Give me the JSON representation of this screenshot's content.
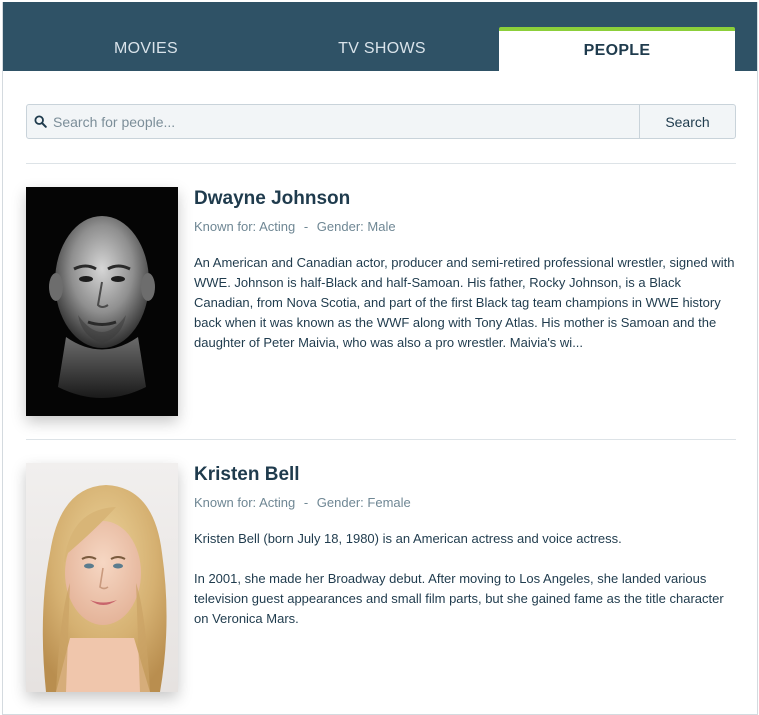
{
  "tabs": [
    {
      "label": "MOVIES",
      "active": false
    },
    {
      "label": "TV SHOWS",
      "active": false
    },
    {
      "label": "PEOPLE",
      "active": true
    }
  ],
  "search": {
    "placeholder": "Search for people...",
    "value": "",
    "button_label": "Search"
  },
  "colors": {
    "header_bg": "#2f5266",
    "active_tab_accent": "#8ccf3a",
    "text_dark": "#1f3b4d",
    "text_muted": "#6f8794"
  },
  "people": [
    {
      "name": "Dwayne Johnson",
      "known_for_label": "Known for:",
      "known_for": "Acting",
      "separator": "-",
      "gender_label": "Gender:",
      "gender": "Male",
      "bio": [
        "An American and Canadian actor, producer and semi-retired professional wrestler, signed with WWE.  Johnson is half-Black and half-Samoan. His father, Rocky Johnson, is a Black Canadian, from Nova Scotia, and part of the first Black tag team champions in WWE history back when it was known as the WWF along with Tony Atlas. His mother is Samoan and the daughter of Peter Maivia, who was also a pro wrestler. Maivia's wi..."
      ]
    },
    {
      "name": "Kristen Bell",
      "known_for_label": "Known for:",
      "known_for": "Acting",
      "separator": "-",
      "gender_label": "Gender:",
      "gender": "Female",
      "bio": [
        "Kristen Bell (born July 18, 1980) is an American actress and voice actress.",
        "In 2001, she made her Broadway debut. After moving to Los Angeles, she landed various television guest appearances and small film parts, but she gained fame as the title character on Veronica Mars."
      ]
    }
  ]
}
